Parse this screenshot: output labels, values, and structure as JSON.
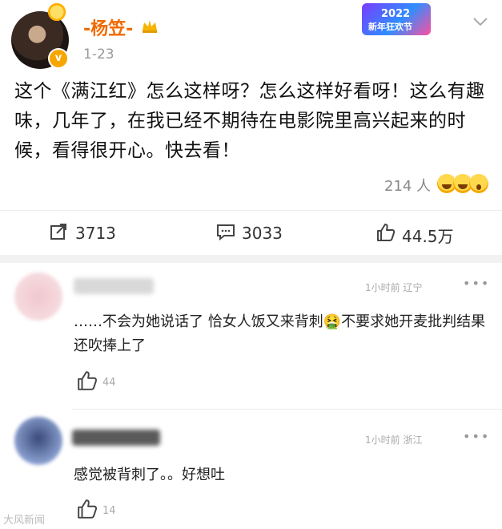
{
  "post": {
    "username": "-杨笠-",
    "date": "1-23",
    "event_badge": {
      "year": "2022",
      "text": "新年狂欢节"
    },
    "text": "这个《满江红》怎么这样呀？怎么这样好看呀！这么有趣味，几年了，在我已经不期待在电影院里高兴起来的时候，看得很开心。快去看！",
    "reactions_count": "214 人",
    "actions": {
      "repost": "3713",
      "comment": "3033",
      "like": "44.5万"
    }
  },
  "comments": [
    {
      "time_location": "1小时前 辽宁",
      "text": "……不会为她说话了 恰女人饭又来背刺🤮不要求她开麦批判结果还吹捧上了",
      "likes": "44"
    },
    {
      "time_location": "1小时前 浙江",
      "text": "感觉被背刺了。。好想吐",
      "likes": "14"
    }
  ],
  "watermark": "大风新闻",
  "colors": {
    "username": "#f06a00",
    "accent_badge": "#f7a600"
  }
}
